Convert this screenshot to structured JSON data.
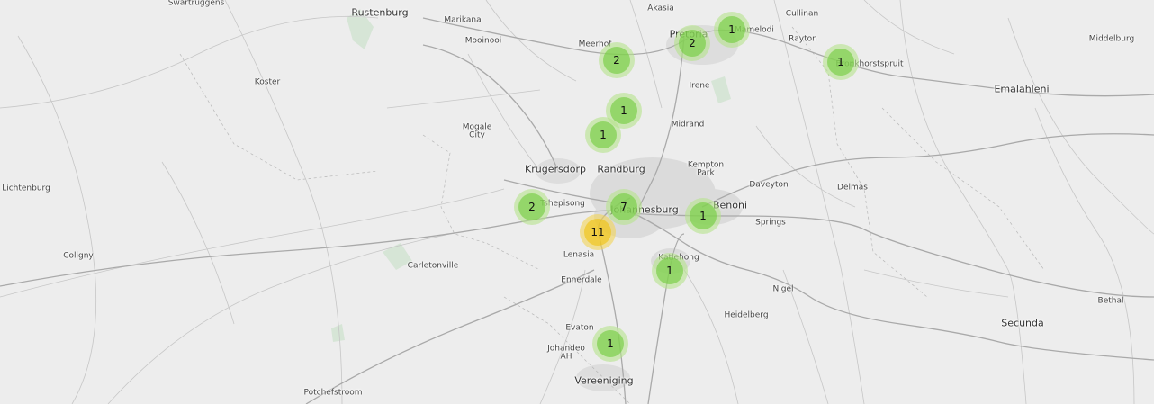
{
  "map": {
    "place_labels": [
      {
        "id": "swartruggens",
        "text": "Swartruggens",
        "size": "small"
      },
      {
        "id": "rustenburg",
        "text": "Rustenburg",
        "size": "medium"
      },
      {
        "id": "marikana",
        "text": "Marikana",
        "size": "small"
      },
      {
        "id": "mooinooi",
        "text": "Mooinooi",
        "size": "small"
      },
      {
        "id": "akasia",
        "text": "Akasia",
        "size": "small"
      },
      {
        "id": "pretoria",
        "text": "Pretoria",
        "size": "medium"
      },
      {
        "id": "mamelodi",
        "text": "Mamelodi",
        "size": "small"
      },
      {
        "id": "cullinan",
        "text": "Cullinan",
        "size": "small"
      },
      {
        "id": "rayton",
        "text": "Rayton",
        "size": "small"
      },
      {
        "id": "middelburg",
        "text": "Middelburg",
        "size": "small"
      },
      {
        "id": "meerhof",
        "text": "Meerhof",
        "size": "small"
      },
      {
        "id": "bronkhorstspruit",
        "text": "Bronkhorstspruit",
        "size": "small"
      },
      {
        "id": "emalahleni",
        "text": "Emalahleni",
        "size": "medium"
      },
      {
        "id": "koster",
        "text": "Koster",
        "size": "small"
      },
      {
        "id": "irene",
        "text": "Irene",
        "size": "small"
      },
      {
        "id": "mogale-city",
        "text": "Mogale\nCity",
        "size": "small"
      },
      {
        "id": "midrand",
        "text": "Midrand",
        "size": "small"
      },
      {
        "id": "krugersdorp",
        "text": "Krugersdorp",
        "size": "medium"
      },
      {
        "id": "randburg",
        "text": "Randburg",
        "size": "medium"
      },
      {
        "id": "kempton-park",
        "text": "Kempton\nPark",
        "size": "small"
      },
      {
        "id": "daveyton",
        "text": "Daveyton",
        "size": "small"
      },
      {
        "id": "delmas",
        "text": "Delmas",
        "size": "small"
      },
      {
        "id": "lichtenburg",
        "text": "Lichtenburg",
        "size": "small"
      },
      {
        "id": "tshepisong",
        "text": "Tshepisong",
        "size": "small"
      },
      {
        "id": "johannesburg",
        "text": "Johannesburg",
        "size": "medium"
      },
      {
        "id": "benoni",
        "text": "Benoni",
        "size": "medium"
      },
      {
        "id": "springs",
        "text": "Springs",
        "size": "small"
      },
      {
        "id": "coligny",
        "text": "Coligny",
        "size": "small"
      },
      {
        "id": "carletonville",
        "text": "Carletonville",
        "size": "small"
      },
      {
        "id": "lenasia",
        "text": "Lenasia",
        "size": "small"
      },
      {
        "id": "katlehong",
        "text": "Katlehong",
        "size": "small"
      },
      {
        "id": "ennerdale",
        "text": "Ennerdale",
        "size": "small"
      },
      {
        "id": "nigel",
        "text": "Nigel",
        "size": "small"
      },
      {
        "id": "bethal",
        "text": "Bethal",
        "size": "small"
      },
      {
        "id": "heidelberg",
        "text": "Heidelberg",
        "size": "small"
      },
      {
        "id": "secunda",
        "text": "Secunda",
        "size": "medium"
      },
      {
        "id": "evaton",
        "text": "Evaton",
        "size": "small"
      },
      {
        "id": "johandeo-ah",
        "text": "Johandeo\nAH",
        "size": "small"
      },
      {
        "id": "vereeniging",
        "text": "Vereeniging",
        "size": "medium"
      },
      {
        "id": "potchefstroom",
        "text": "Potchefstroom",
        "size": "small"
      }
    ],
    "clusters": [
      {
        "id": "pretoria-north",
        "count": "1",
        "tier": "small"
      },
      {
        "id": "pretoria",
        "count": "2",
        "tier": "small"
      },
      {
        "id": "bronkhorstspruit",
        "count": "1",
        "tier": "small"
      },
      {
        "id": "meerhof",
        "count": "2",
        "tier": "small"
      },
      {
        "id": "north-randburg-1",
        "count": "1",
        "tier": "small"
      },
      {
        "id": "north-randburg-2",
        "count": "1",
        "tier": "small"
      },
      {
        "id": "tshepisong",
        "count": "2",
        "tier": "small"
      },
      {
        "id": "johannesburg",
        "count": "7",
        "tier": "small"
      },
      {
        "id": "soweto",
        "count": "11",
        "tier": "medium"
      },
      {
        "id": "benoni",
        "count": "1",
        "tier": "small"
      },
      {
        "id": "katlehong",
        "count": "1",
        "tier": "small"
      },
      {
        "id": "vereeniging",
        "count": "1",
        "tier": "small"
      }
    ]
  },
  "colors": {
    "background": "#ededed",
    "road": "#bdbdbd",
    "major_road": "#a8a8a8",
    "urban": "#d9d9d9",
    "park": "#d4e6d4",
    "cluster_small": "#6ecc39",
    "cluster_medium": "#f0c20c"
  }
}
